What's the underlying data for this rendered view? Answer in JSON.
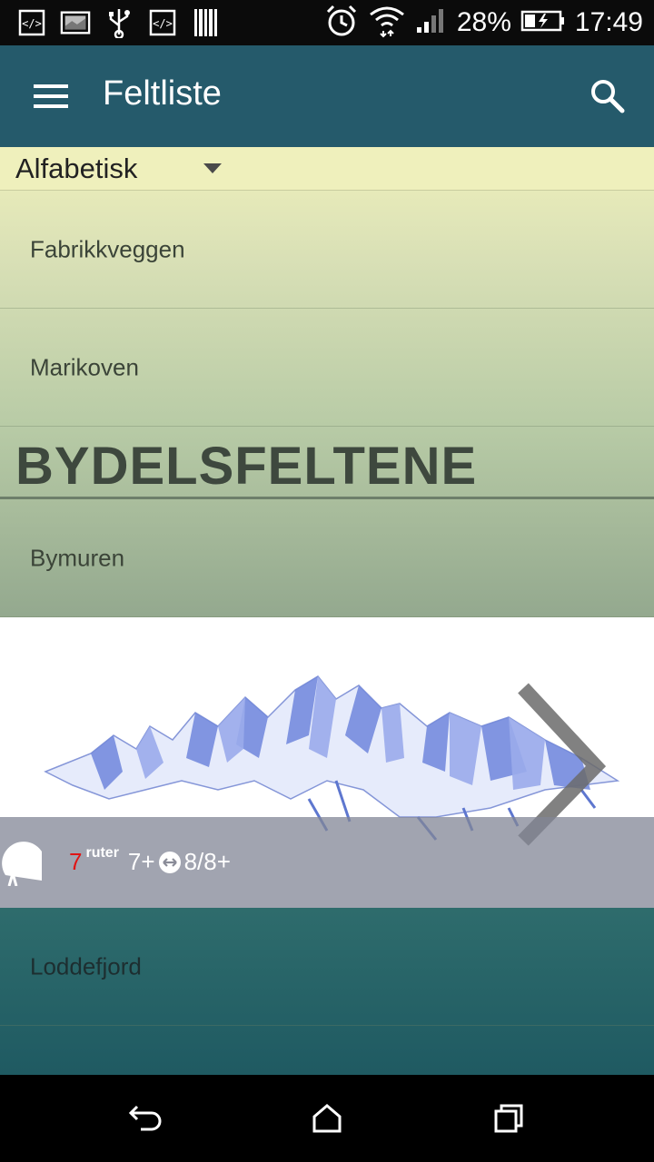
{
  "status_bar": {
    "battery_percent": "28%",
    "time": "17:49",
    "notification_icons": [
      "code-icon",
      "image-icon",
      "usb-icon",
      "code-icon",
      "barcode-icon"
    ],
    "system_icons": [
      "alarm-icon",
      "wifi-icon",
      "signal-icon",
      "battery-charging-icon"
    ]
  },
  "app_bar": {
    "title": "Feltliste",
    "left_icon": "menu-icon",
    "right_icon": "search-icon",
    "color": "#255a6b"
  },
  "sort": {
    "selected": "Alfabetisk"
  },
  "list": {
    "items_top": [
      "Fabrikkveggen",
      "Marikoven"
    ],
    "section_header": "BYDELSFELTENE",
    "items_section": [
      "Bymuren"
    ],
    "featured_card": {
      "routes_count": "7",
      "routes_word": "ruter",
      "min_grade": "7+",
      "range_separator_icon": "range-arrows-icon",
      "max_grade": "8/8+",
      "climber_icon": "climber-icon",
      "image": "mountain-illustration",
      "chevron_icon": "chevron-right-icon"
    },
    "items_bottom": [
      "Loddefjord"
    ]
  },
  "nav_bar": {
    "buttons": [
      "back-icon",
      "home-icon",
      "recents-icon"
    ]
  },
  "colors": {
    "routes_count": "#e01515",
    "sort_bg": "#eff0bc",
    "card_bar": "#9a9ca8"
  }
}
